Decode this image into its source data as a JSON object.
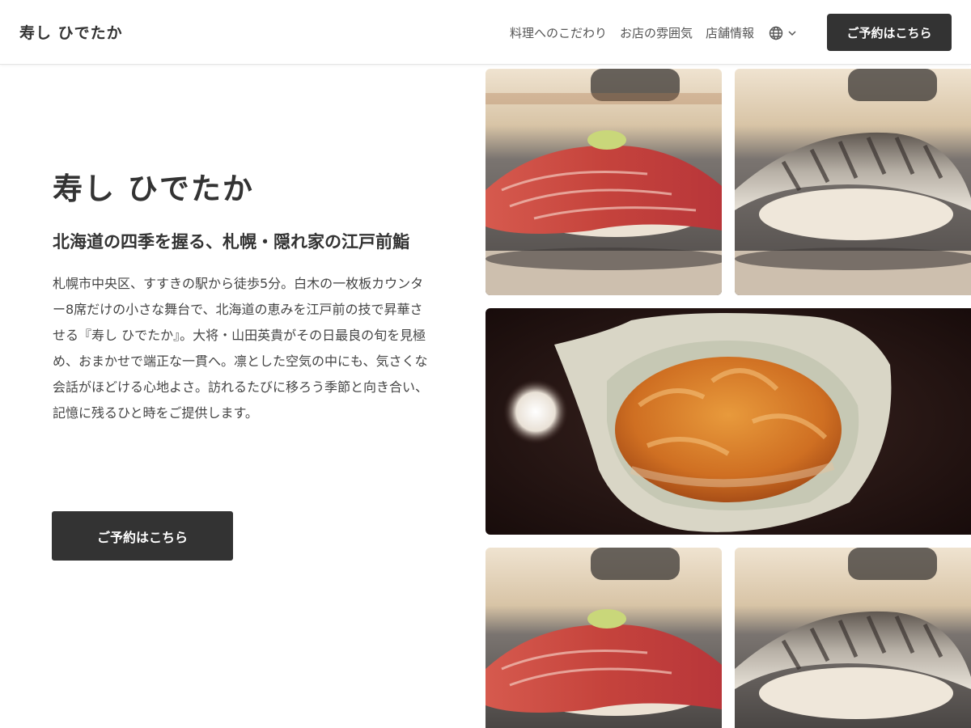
{
  "header": {
    "brand": "寿し ひでたか",
    "nav": [
      {
        "label": "料理へのこだわり"
      },
      {
        "label": "お店の雰囲気"
      },
      {
        "label": "店舗情報"
      }
    ],
    "language_icon": "globe-icon",
    "language_caret_icon": "chevron-down-icon",
    "cta_label": "ご予約はこちら"
  },
  "hero": {
    "title": "寿し ひでたか",
    "subtitle": "北海道の四季を握る、札幌・隠れ家の江戸前鮨",
    "description": "札幌市中央区、すすきの駅から徒歩5分。白木の一枚板カウンター8席だけの小さな舞台で、北海道の恵みを江戸前の技で昇華させる『寿し ひでたか』。大将・山田英貴がその日最良の旬を見極め、おまかせで端正な一貫へ。凛とした空気の中にも、気さくな会話がほどける心地よさ。訪れるたびに移ろう季節と向き合い、記憶に残るひと時をご提供します。",
    "cta_label": "ご予約はこちら"
  },
  "gallery": [
    {
      "subject": "tuna-nigiri"
    },
    {
      "subject": "kohada-nigiri"
    },
    {
      "subject": "uni-bowl"
    },
    {
      "subject": "tuna-nigiri"
    },
    {
      "subject": "kohada-nigiri"
    }
  ],
  "colors": {
    "primary_button": "#333333",
    "text": "#333333",
    "background": "#ffffff"
  }
}
